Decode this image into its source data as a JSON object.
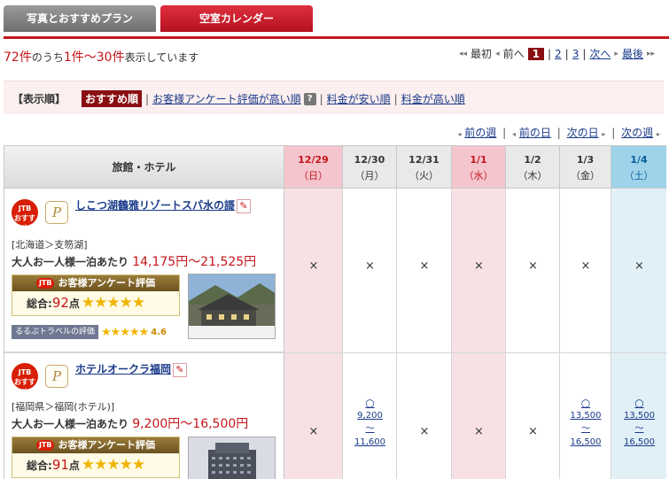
{
  "tabs": [
    {
      "label": "写真とおすすめプラン"
    },
    {
      "label": "空室カレンダー"
    }
  ],
  "results": {
    "total": "72件",
    "text1": "のうち",
    "range": "1件〜30件",
    "text2": "表示しています"
  },
  "pager": {
    "first": "最初",
    "prev": "前へ",
    "pages": [
      "1",
      "2",
      "3"
    ],
    "next": "次へ",
    "last": "最後"
  },
  "sort": {
    "label": "【表示順】",
    "active": "おすすめ順",
    "options": [
      "お客様アンケート評価が高い順",
      "料金が安い順",
      "料金が高い順"
    ],
    "help": "?"
  },
  "weeknav": [
    "前の週",
    "前の日",
    "次の日",
    "次の週"
  ],
  "table": {
    "name_header": "旅館・ホテル",
    "dates": [
      {
        "date": "12/29",
        "day": "（日）",
        "color": "#c4161c",
        "bg": "#f4c5cd"
      },
      {
        "date": "12/30",
        "day": "（月）",
        "color": "#333333",
        "bg": "#e9e9e9"
      },
      {
        "date": "12/31",
        "day": "（火）",
        "color": "#333333",
        "bg": "#e9e9e9"
      },
      {
        "date": "1/1",
        "day": "（水）",
        "color": "#c4161c",
        "bg": "#f4c5cd"
      },
      {
        "date": "1/2",
        "day": "（木）",
        "color": "#333333",
        "bg": "#e9e9e9"
      },
      {
        "date": "1/3",
        "day": "（金）",
        "color": "#333333",
        "bg": "#e9e9e9"
      },
      {
        "date": "1/4",
        "day": "（土）",
        "color": "#0b5e99",
        "bg": "#9fd3ea"
      }
    ],
    "col_bg": [
      "#f7e1e5",
      "#ffffff",
      "#ffffff",
      "#f7e1e5",
      "#ffffff",
      "#ffffff",
      "#e1f0f6"
    ]
  },
  "hotels": [
    {
      "badge": "JTB\nおすすめ",
      "p_icon": "P",
      "name": "しこつ湖鶴雅リゾートスパ水の謌",
      "area": "[北海道＞支笏湖]",
      "price_label": "大人お一人様一泊あたり",
      "price": "14,175円〜21,525円",
      "survey_title": "お客様アンケート評価",
      "jtb_mini": "JTB",
      "total_label": "総合:",
      "score": "92",
      "score_unit": "点",
      "stars": "★★★★★",
      "rurubu_label": "るるぶトラベルの評価",
      "rurubu_stars": "★★★★★",
      "rurubu_score": "4.6",
      "cells": [
        {
          "mark": "×"
        },
        {
          "mark": "×"
        },
        {
          "mark": "×"
        },
        {
          "mark": "×"
        },
        {
          "mark": "×"
        },
        {
          "mark": "×"
        },
        {
          "mark": "×"
        }
      ]
    },
    {
      "badge": "JTB\nおすすめ",
      "p_icon": "P",
      "name": "ホテルオークラ福岡",
      "area": "[福岡県＞福岡(ホテル)]",
      "price_label": "大人お一人様一泊あたり",
      "price": "9,200円〜16,500円",
      "survey_title": "お客様アンケート評価",
      "jtb_mini": "JTB",
      "total_label": "総合:",
      "score": "91",
      "score_unit": "点",
      "stars": "★★★★★",
      "cells": [
        {
          "mark": "×"
        },
        {
          "mark": "○",
          "low": "9,200",
          "tilde": "〜",
          "high": "11,600"
        },
        {
          "mark": "×"
        },
        {
          "mark": "×"
        },
        {
          "mark": "×"
        },
        {
          "mark": "○",
          "low": "13,500",
          "tilde": "〜",
          "high": "16,500"
        },
        {
          "mark": "○",
          "low": "13,500",
          "tilde": "〜",
          "high": "16,500"
        }
      ]
    }
  ]
}
